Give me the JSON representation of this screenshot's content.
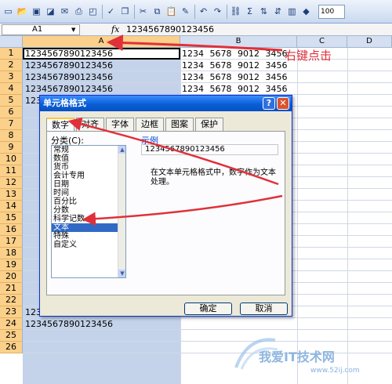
{
  "toolbar": {
    "icons": [
      "new-icon",
      "open-icon",
      "save-icon",
      "permission-icon",
      "email-icon",
      "print-icon",
      "print-preview-icon",
      "spelling-icon",
      "research-icon",
      "cut-icon",
      "copy-icon",
      "paste-icon",
      "format-painter-icon",
      "undo-icon",
      "redo-icon",
      "insert-hyperlink-icon",
      "autosum-icon",
      "sort-ascending-icon",
      "sort-descending-icon",
      "chart-wizard-icon",
      "drawing-icon",
      "zoom"
    ],
    "zoom_value": "100"
  },
  "formula_bar": {
    "name_box": "A1",
    "fx_label": "fx",
    "value": "1234567890123456"
  },
  "columns": [
    "A",
    "B",
    "C",
    "D"
  ],
  "rows": [
    "1",
    "2",
    "3",
    "4",
    "5",
    "6",
    "7",
    "8",
    "9",
    "10",
    "11",
    "12",
    "13",
    "14",
    "15",
    "16",
    "17",
    "18",
    "19",
    "20",
    "21",
    "22",
    "23",
    "24",
    "25",
    "26"
  ],
  "column_a": {
    "cell_value": "1234567890123456",
    "visible_rows": [
      1,
      2,
      3,
      4,
      5,
      23,
      24
    ]
  },
  "column_b": {
    "cell_value": "1234 5678 9012 3456",
    "visible_rows": [
      1,
      2,
      3,
      4
    ]
  },
  "annotation_text": "右键点击",
  "dialog": {
    "title": "单元格格式",
    "help_label": "?",
    "close_label": "✕",
    "tabs": [
      "数字",
      "对齐",
      "字体",
      "边框",
      "图案",
      "保护"
    ],
    "active_tab": "数字",
    "category_label": "分类(C):",
    "categories": [
      "常规",
      "数值",
      "货币",
      "会计专用",
      "日期",
      "时间",
      "百分比",
      "分数",
      "科学记数",
      "文本",
      "特殊",
      "自定义"
    ],
    "selected_category": "文本",
    "sample_label": "示例",
    "sample_value": "1234567890123456",
    "description": "在文本单元格格式中，数字作为文本处理。",
    "ok_label": "确定",
    "cancel_label": "取消"
  },
  "watermark": {
    "text": "我爱IT技术网",
    "url": "www.52ij.com"
  },
  "colors": {
    "selection_blue": "#c4d3ea",
    "header_orange": "#fbd08a",
    "annotation_red": "#e0303a",
    "title_blue": "#0a5fd6"
  }
}
